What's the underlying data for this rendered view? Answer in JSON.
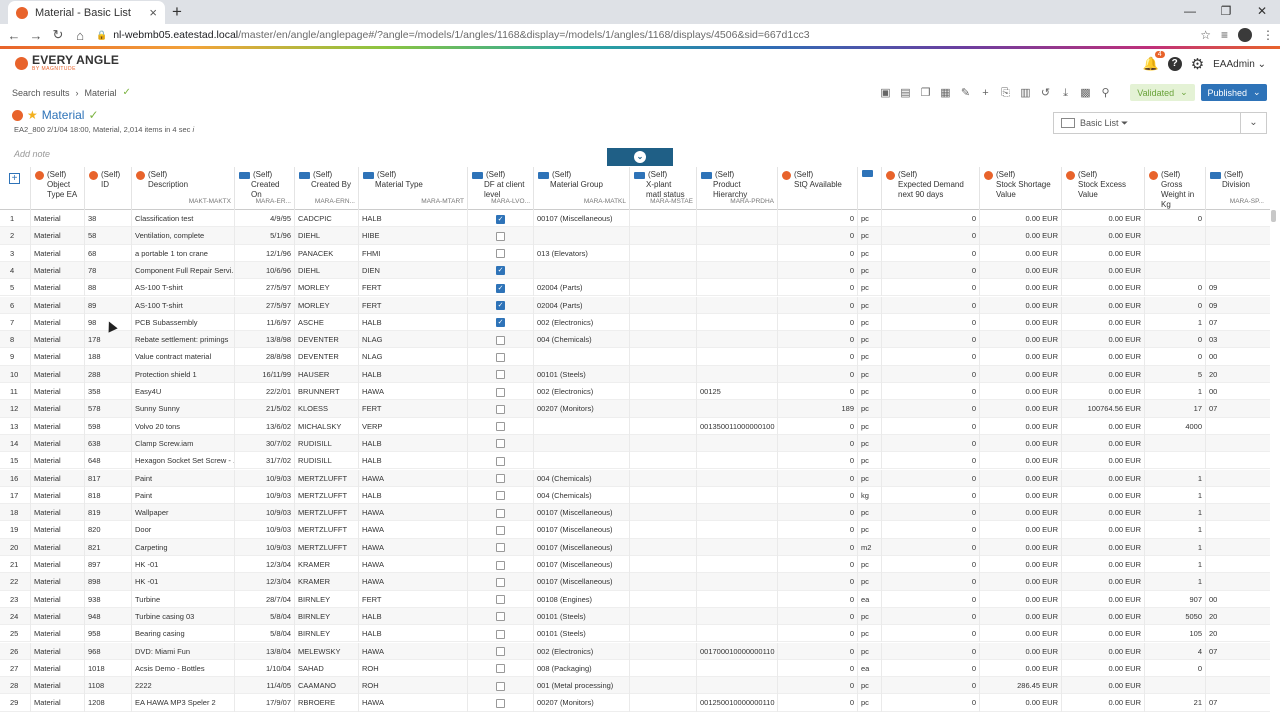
{
  "browser": {
    "tab_title": "Material - Basic List",
    "tab_close": "×",
    "new_tab": "+",
    "window_buttons": [
      "—",
      "❐",
      "✕"
    ],
    "url_host": "nl-webmb05.eatestad.local",
    "url_path": "/master/en/angle/anglepage#/?angle=/models/1/angles/1168&display=/models/1/angles/1168/displays/4506&sid=667d1cc3"
  },
  "app": {
    "logo_name": "EVERY ANGLE",
    "logo_sub": "BY MAGNITUDE",
    "notifications_count": "4",
    "user": "EAAdmin"
  },
  "breadcrumb": {
    "first": "Search results",
    "current": "Material"
  },
  "status": {
    "validated": "Validated",
    "published": "Published"
  },
  "angle": {
    "title": "Material",
    "summary": "EA2_800 2/1/04 18:00, Material, 2,014 items in 4 sec",
    "add_note": "Add note",
    "display_name": "Basic List"
  },
  "columns": [
    {
      "self": "(Self)",
      "label": "Object\nType EA",
      "tech": "",
      "icon": "orange"
    },
    {
      "self": "(Self)",
      "label": "ID",
      "tech": "",
      "icon": "orange"
    },
    {
      "self": "(Self)",
      "label": "Description",
      "tech": "MAKT-MAKTX",
      "icon": "orange"
    },
    {
      "self": "(Self)",
      "label": "Created\nOn",
      "tech": "MARA-ER...",
      "icon": "blue"
    },
    {
      "self": "(Self)",
      "label": "Created By",
      "tech": "MARA-ERN...",
      "icon": "blue"
    },
    {
      "self": "(Self)",
      "label": "Material Type",
      "tech": "MARA-MTART",
      "icon": "blue"
    },
    {
      "self": "(Self)",
      "label": "DF at client\nlevel",
      "tech": "MARA-LVO...",
      "icon": "blue"
    },
    {
      "self": "(Self)",
      "label": "Material Group",
      "tech": "MARA-MATKL",
      "icon": "blue"
    },
    {
      "self": "(Self)",
      "label": "X-plant\nmatl status",
      "tech": "MARA-MSTAE",
      "icon": "blue"
    },
    {
      "self": "(Self)",
      "label": "Product\nHierarchy",
      "tech": "MARA-PRDHA",
      "icon": "blue"
    },
    {
      "self": "(Self)",
      "label": "StQ Available",
      "tech": "",
      "icon": "orange"
    },
    {
      "self": "",
      "label": "",
      "tech": "",
      "icon": "blue"
    },
    {
      "self": "(Self)",
      "label": "Expected Demand\nnext 90 days",
      "tech": "",
      "icon": "orange"
    },
    {
      "self": "(Self)",
      "label": "Stock Shortage\nValue",
      "tech": "",
      "icon": "orange"
    },
    {
      "self": "(Self)",
      "label": "Stock Excess\nValue",
      "tech": "",
      "icon": "orange"
    },
    {
      "self": "(Self)",
      "label": "Gross\nWeight in Kg",
      "tech": "",
      "icon": "orange"
    },
    {
      "self": "(Self)",
      "label": "Division",
      "tech": "MARA-SP...",
      "icon": "blue"
    }
  ],
  "rows": [
    [
      "1",
      "Material",
      "38",
      "Classification test",
      "4/9/95",
      "CADCPIC",
      "HALB",
      true,
      "00107 (Miscellaneous)",
      "",
      "",
      "0",
      "pc",
      "0",
      "0.00 EUR",
      "0.00 EUR",
      "0",
      ""
    ],
    [
      "2",
      "Material",
      "58",
      "Ventilation, complete",
      "5/1/96",
      "DIEHL",
      "HIBE",
      false,
      "",
      "",
      "",
      "0",
      "pc",
      "0",
      "0.00 EUR",
      "0.00 EUR",
      "",
      ""
    ],
    [
      "3",
      "Material",
      "68",
      "a portable 1 ton crane",
      "12/1/96",
      "PANACEK",
      "FHMI",
      false,
      "013 (Elevators)",
      "",
      "",
      "0",
      "pc",
      "0",
      "0.00 EUR",
      "0.00 EUR",
      "",
      ""
    ],
    [
      "4",
      "Material",
      "78",
      "Component Full Repair Servi...",
      "10/6/96",
      "DIEHL",
      "DIEN",
      true,
      "",
      "",
      "",
      "0",
      "pc",
      "0",
      "0.00 EUR",
      "0.00 EUR",
      "",
      ""
    ],
    [
      "5",
      "Material",
      "88",
      "AS-100 T-shirt",
      "27/5/97",
      "MORLEY",
      "FERT",
      true,
      "02004 (Parts)",
      "",
      "",
      "0",
      "pc",
      "0",
      "0.00 EUR",
      "0.00 EUR",
      "0",
      "09"
    ],
    [
      "6",
      "Material",
      "89",
      "AS-100 T-shirt",
      "27/5/97",
      "MORLEY",
      "FERT",
      true,
      "02004 (Parts)",
      "",
      "",
      "0",
      "pc",
      "0",
      "0.00 EUR",
      "0.00 EUR",
      "0",
      "09"
    ],
    [
      "7",
      "Material",
      "98",
      "PCB Subassembly",
      "11/6/97",
      "ASCHE",
      "HALB",
      true,
      "002 (Electronics)",
      "",
      "",
      "0",
      "pc",
      "0",
      "0.00 EUR",
      "0.00 EUR",
      "1",
      "07"
    ],
    [
      "8",
      "Material",
      "178",
      "Rebate settlement: primings",
      "13/8/98",
      "DEVENTER",
      "NLAG",
      false,
      "004 (Chemicals)",
      "",
      "",
      "0",
      "pc",
      "0",
      "0.00 EUR",
      "0.00 EUR",
      "0",
      "03"
    ],
    [
      "9",
      "Material",
      "188",
      "Value contract material",
      "28/8/98",
      "DEVENTER",
      "NLAG",
      false,
      "",
      "",
      "",
      "0",
      "pc",
      "0",
      "0.00 EUR",
      "0.00 EUR",
      "0",
      "00"
    ],
    [
      "10",
      "Material",
      "288",
      "Protection shield 1",
      "16/11/99",
      "HAUSER",
      "HALB",
      false,
      "00101 (Steels)",
      "",
      "",
      "0",
      "pc",
      "0",
      "0.00 EUR",
      "0.00 EUR",
      "5",
      "20"
    ],
    [
      "11",
      "Material",
      "358",
      "Easy4U",
      "22/2/01",
      "BRUNNERT",
      "HAWA",
      false,
      "002 (Electronics)",
      "",
      "00125",
      "0",
      "pc",
      "0",
      "0.00 EUR",
      "0.00 EUR",
      "1",
      "00"
    ],
    [
      "12",
      "Material",
      "578",
      "Sunny Sunny",
      "21/5/02",
      "KLOESS",
      "FERT",
      false,
      "00207 (Monitors)",
      "",
      "",
      "189",
      "pc",
      "0",
      "0.00 EUR",
      "100764.56 EUR",
      "17",
      "07"
    ],
    [
      "13",
      "Material",
      "598",
      "Volvo 20 tons",
      "13/6/02",
      "MICHALSKY",
      "VERP",
      false,
      "",
      "",
      "001350011000000100",
      "0",
      "pc",
      "0",
      "0.00 EUR",
      "0.00 EUR",
      "4000",
      ""
    ],
    [
      "14",
      "Material",
      "638",
      "Clamp Screw.iam",
      "30/7/02",
      "RUDISILL",
      "HALB",
      false,
      "",
      "",
      "",
      "0",
      "pc",
      "0",
      "0.00 EUR",
      "0.00 EUR",
      "",
      ""
    ],
    [
      "15",
      "Material",
      "648",
      "Hexagon Socket Set Screw - ...",
      "31/7/02",
      "RUDISILL",
      "HALB",
      false,
      "",
      "",
      "",
      "0",
      "pc",
      "0",
      "0.00 EUR",
      "0.00 EUR",
      "",
      ""
    ],
    [
      "16",
      "Material",
      "817",
      "Paint",
      "10/9/03",
      "MERTZLUFFT",
      "HAWA",
      false,
      "004 (Chemicals)",
      "",
      "",
      "0",
      "pc",
      "0",
      "0.00 EUR",
      "0.00 EUR",
      "1",
      ""
    ],
    [
      "17",
      "Material",
      "818",
      "Paint",
      "10/9/03",
      "MERTZLUFFT",
      "HALB",
      false,
      "004 (Chemicals)",
      "",
      "",
      "0",
      "kg",
      "0",
      "0.00 EUR",
      "0.00 EUR",
      "1",
      ""
    ],
    [
      "18",
      "Material",
      "819",
      "Wallpaper",
      "10/9/03",
      "MERTZLUFFT",
      "HAWA",
      false,
      "00107 (Miscellaneous)",
      "",
      "",
      "0",
      "pc",
      "0",
      "0.00 EUR",
      "0.00 EUR",
      "1",
      ""
    ],
    [
      "19",
      "Material",
      "820",
      "Door",
      "10/9/03",
      "MERTZLUFFT",
      "HAWA",
      false,
      "00107 (Miscellaneous)",
      "",
      "",
      "0",
      "pc",
      "0",
      "0.00 EUR",
      "0.00 EUR",
      "1",
      ""
    ],
    [
      "20",
      "Material",
      "821",
      "Carpeting",
      "10/9/03",
      "MERTZLUFFT",
      "HAWA",
      false,
      "00107 (Miscellaneous)",
      "",
      "",
      "0",
      "m2",
      "0",
      "0.00 EUR",
      "0.00 EUR",
      "1",
      ""
    ],
    [
      "21",
      "Material",
      "897",
      "HK -01",
      "12/3/04",
      "KRAMER",
      "HAWA",
      false,
      "00107 (Miscellaneous)",
      "",
      "",
      "0",
      "pc",
      "0",
      "0.00 EUR",
      "0.00 EUR",
      "1",
      ""
    ],
    [
      "22",
      "Material",
      "898",
      "HK -01",
      "12/3/04",
      "KRAMER",
      "HAWA",
      false,
      "00107 (Miscellaneous)",
      "",
      "",
      "0",
      "pc",
      "0",
      "0.00 EUR",
      "0.00 EUR",
      "1",
      ""
    ],
    [
      "23",
      "Material",
      "938",
      "Turbine",
      "28/7/04",
      "BIRNLEY",
      "FERT",
      false,
      "00108 (Engines)",
      "",
      "",
      "0",
      "ea",
      "0",
      "0.00 EUR",
      "0.00 EUR",
      "907",
      "00"
    ],
    [
      "24",
      "Material",
      "948",
      "Turbine casing 03",
      "5/8/04",
      "BIRNLEY",
      "HALB",
      false,
      "00101 (Steels)",
      "",
      "",
      "0",
      "pc",
      "0",
      "0.00 EUR",
      "0.00 EUR",
      "5050",
      "20"
    ],
    [
      "25",
      "Material",
      "958",
      "Bearing casing",
      "5/8/04",
      "BIRNLEY",
      "HALB",
      false,
      "00101 (Steels)",
      "",
      "",
      "0",
      "pc",
      "0",
      "0.00 EUR",
      "0.00 EUR",
      "105",
      "20"
    ],
    [
      "26",
      "Material",
      "968",
      "DVD: Miami Fun",
      "13/8/04",
      "MELEWSKY",
      "HAWA",
      false,
      "002 (Electronics)",
      "",
      "001700010000000110",
      "0",
      "pc",
      "0",
      "0.00 EUR",
      "0.00 EUR",
      "4",
      "07"
    ],
    [
      "27",
      "Material",
      "1018",
      "Acsis Demo - Bottles",
      "1/10/04",
      "SAHAD",
      "ROH",
      false,
      "008 (Packaging)",
      "",
      "",
      "0",
      "ea",
      "0",
      "0.00 EUR",
      "0.00 EUR",
      "0",
      ""
    ],
    [
      "28",
      "Material",
      "1108",
      "2222",
      "11/4/05",
      "CAAMANO",
      "ROH",
      false,
      "001 (Metal processing)",
      "",
      "",
      "0",
      "pc",
      "0",
      "286.45 EUR",
      "0.00 EUR",
      "",
      ""
    ],
    [
      "29",
      "Material",
      "1208",
      "EA HAWA MP3 Speler 2",
      "17/9/07",
      "RBROERE",
      "HAWA",
      false,
      "00207 (Monitors)",
      "",
      "001250010000000110",
      "0",
      "pc",
      "0",
      "0.00 EUR",
      "0.00 EUR",
      "21",
      "07"
    ]
  ]
}
